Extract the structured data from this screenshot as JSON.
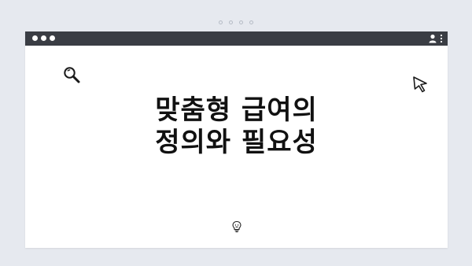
{
  "headline": {
    "line1": "맞춤형 급여의",
    "line2": "정의와 필요성"
  },
  "titlebar": {
    "traffic_lights": [
      "dot",
      "dot",
      "dot"
    ],
    "right_icons": [
      "user-icon",
      "kebab-icon"
    ]
  },
  "pagination": {
    "count": 4
  },
  "icons": {
    "search": "search-icon",
    "cursor": "cursor-arrow-icon",
    "bulb": "lightbulb-icon"
  },
  "colors": {
    "background": "#e6e9ef",
    "titlebar": "#3a3d44",
    "window": "#ffffff",
    "text": "#111111"
  }
}
